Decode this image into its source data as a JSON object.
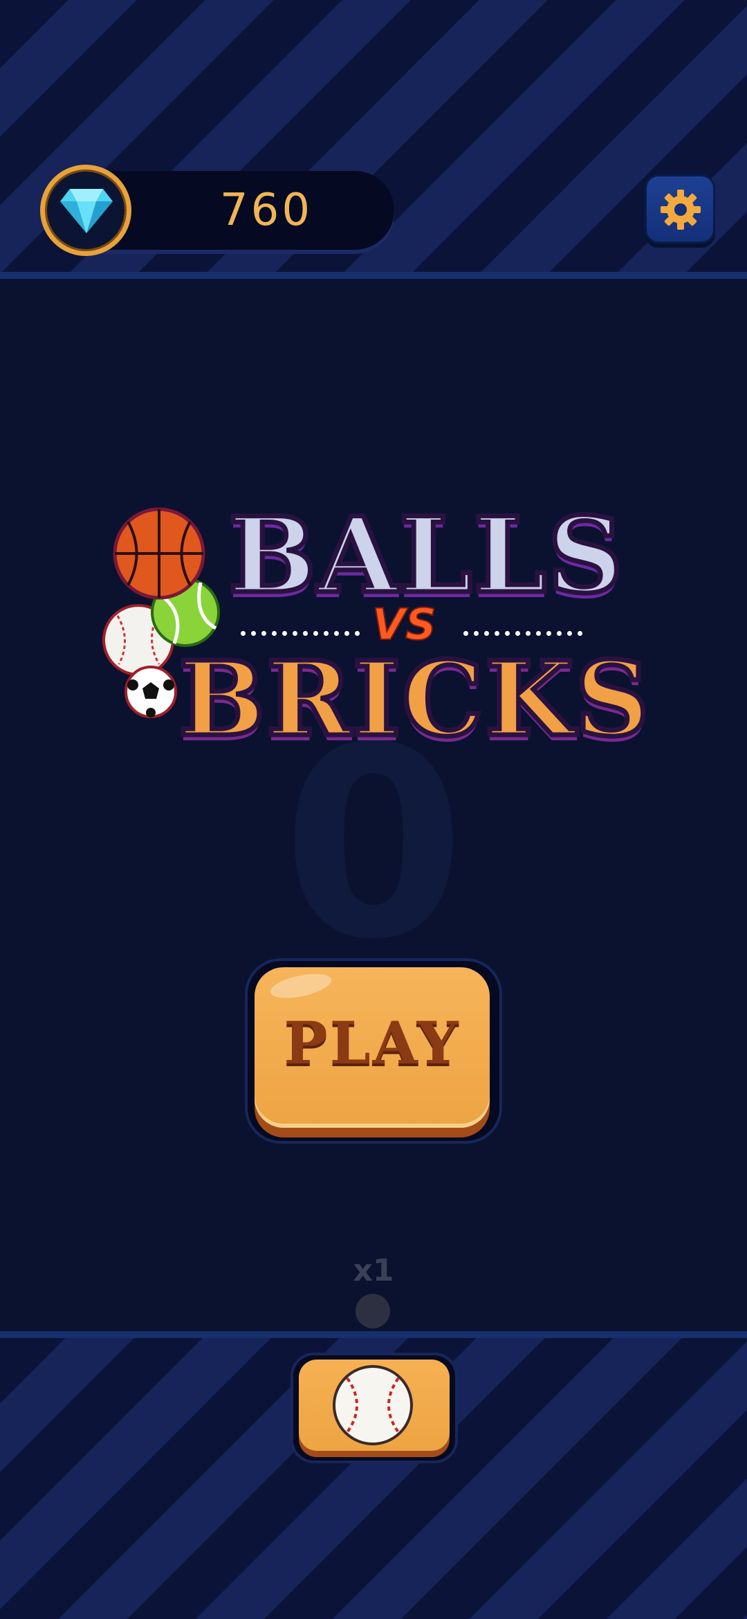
{
  "header": {
    "gem_count": "760",
    "gem_icon": "diamond-icon",
    "settings_icon": "gear-icon"
  },
  "logo": {
    "line1": "BALLS",
    "connector": "VS",
    "line2": "BRICKS"
  },
  "main": {
    "score_ghost": "0",
    "play_label": "PLAY",
    "multiplier": "x1"
  },
  "footer": {
    "ball_selector_icon": "baseball-icon"
  },
  "colors": {
    "accent_orange": "#eda443",
    "gem_text": "#f2b457",
    "background": "#0a1230"
  }
}
